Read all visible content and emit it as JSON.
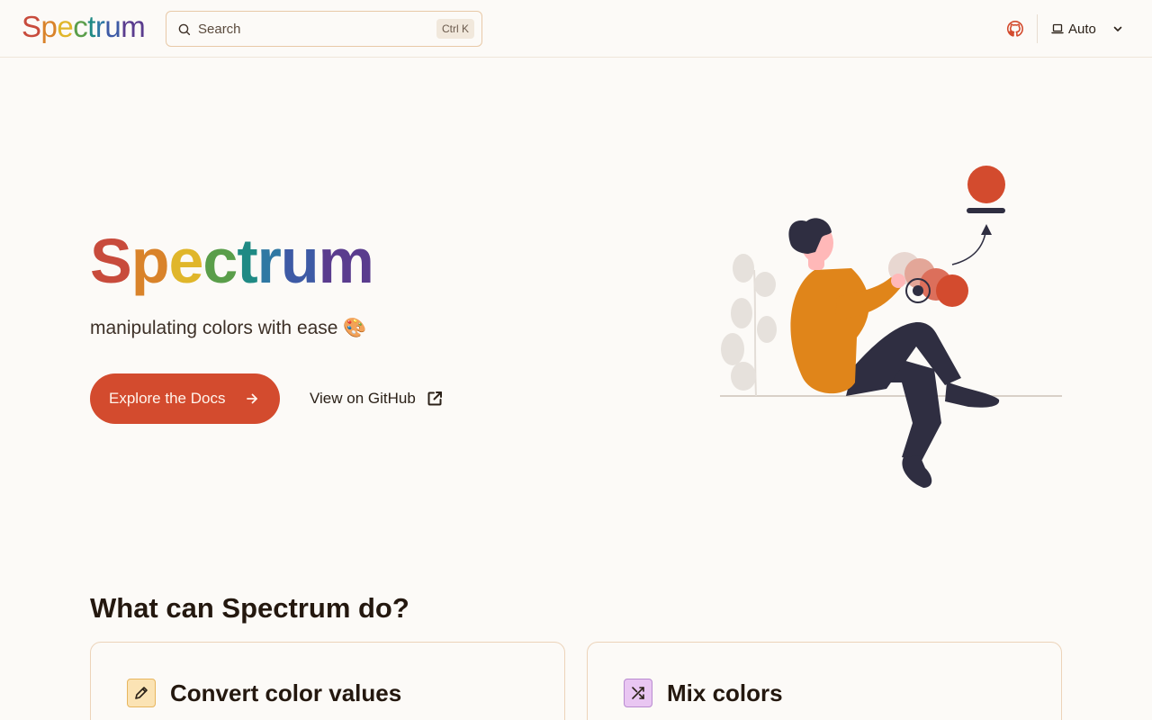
{
  "header": {
    "logo_letters": [
      "S",
      "p",
      "e",
      "c",
      "t",
      "r",
      "u",
      "m"
    ],
    "search": {
      "placeholder": "Search",
      "shortcut": "Ctrl K"
    },
    "github_icon": "github-icon",
    "theme": {
      "icon": "laptop-icon",
      "label": "Auto",
      "chevron": "chevron-down-icon"
    }
  },
  "hero": {
    "title_letters": [
      "S",
      "p",
      "e",
      "c",
      "t",
      "r",
      "u",
      "m"
    ],
    "tagline": "manipulating colors with ease 🎨",
    "primary_button": {
      "label": "Explore the Docs",
      "icon": "arrow-right-icon"
    },
    "secondary_button": {
      "label": "View on GitHub",
      "icon": "external-link-icon"
    }
  },
  "features": {
    "title": "What can Spectrum do?",
    "cards": [
      {
        "title": "Convert color values",
        "icon": "pencil-icon"
      },
      {
        "title": "Mix colors",
        "icon": "shuffle-icon"
      }
    ]
  },
  "colors": {
    "brand_letters": [
      "#c84b3c",
      "#d9832a",
      "#e0b62a",
      "#5a9e4a",
      "#1f8a84",
      "#2f78a3",
      "#3d5aa5",
      "#5a3c8e"
    ],
    "accent": "#d34b2e",
    "background": "#fcfaf7"
  }
}
